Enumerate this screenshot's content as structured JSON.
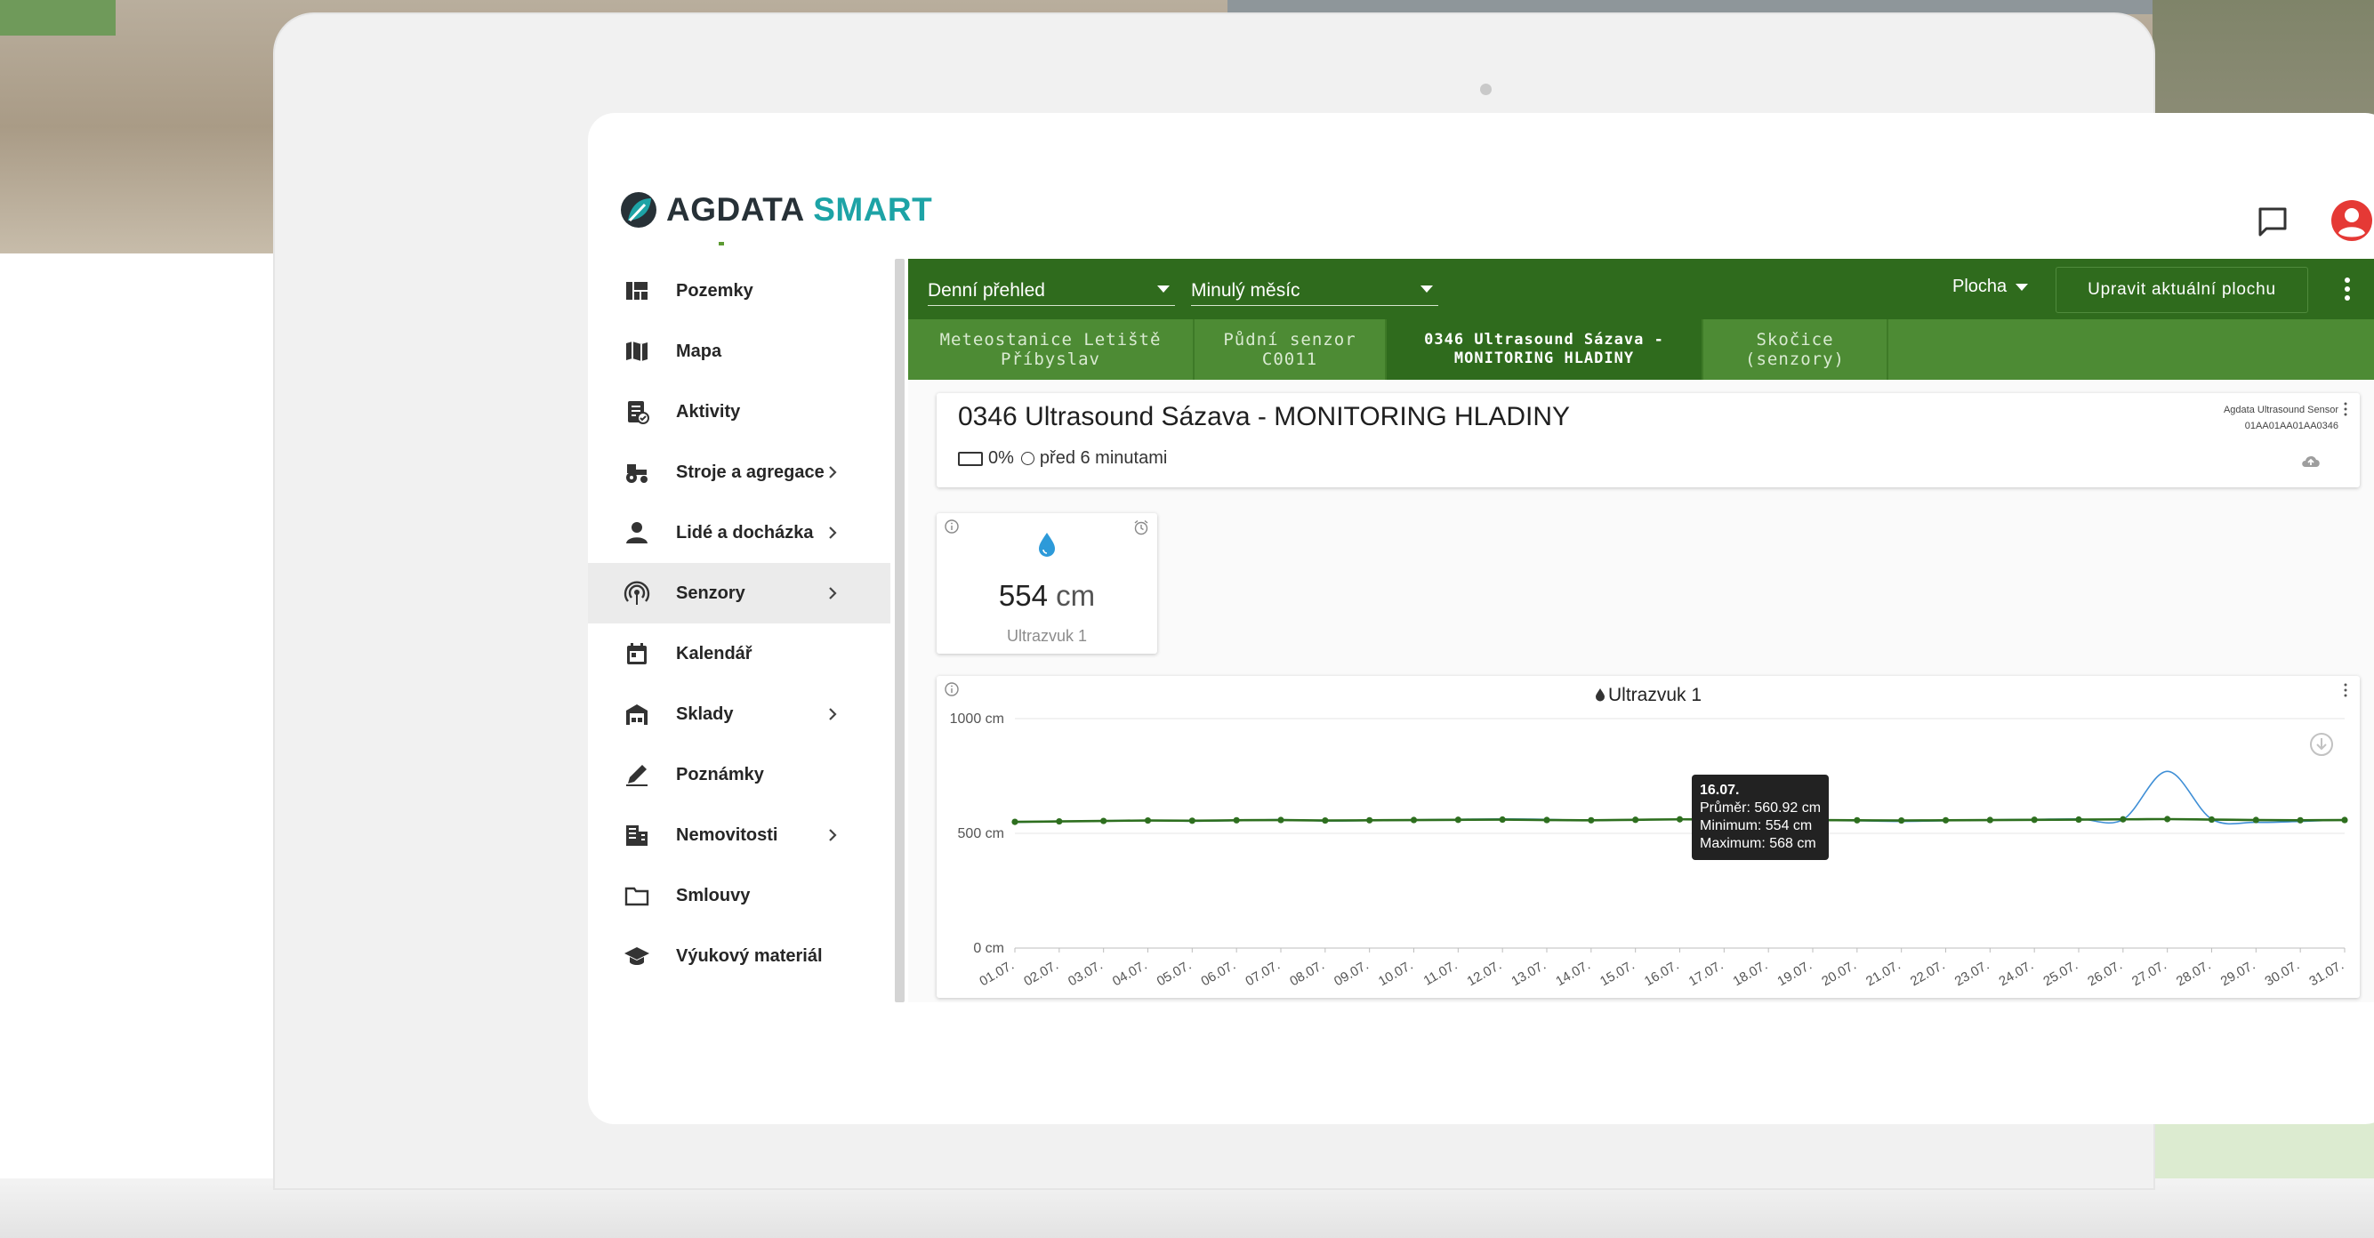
{
  "app": {
    "logo_main": "AGDATA",
    "logo_accent": "SMART",
    "brand_color": "#1da3a6",
    "toolbar_color": "#2f6b1d",
    "tab_color": "#4d8b34",
    "user_color": "#e53935"
  },
  "header": {
    "chat_icon": "chat-icon",
    "user_icon": "account-circle-icon"
  },
  "sidebar": {
    "items": [
      {
        "label": "Pozemky",
        "icon": "dashboard-icon",
        "has_children": false,
        "active": false
      },
      {
        "label": "Mapa",
        "icon": "map-icon",
        "has_children": false,
        "active": false
      },
      {
        "label": "Aktivity",
        "icon": "task-list-icon",
        "has_children": false,
        "active": false
      },
      {
        "label": "Stroje a agregace",
        "icon": "tractor-icon",
        "has_children": true,
        "active": false
      },
      {
        "label": "Lidé a docházka",
        "icon": "person-icon",
        "has_children": true,
        "active": false
      },
      {
        "label": "Senzory",
        "icon": "sensor-icon",
        "has_children": true,
        "active": true
      },
      {
        "label": "Kalendář",
        "icon": "calendar-icon",
        "has_children": false,
        "active": false
      },
      {
        "label": "Sklady",
        "icon": "warehouse-icon",
        "has_children": true,
        "active": false
      },
      {
        "label": "Poznámky",
        "icon": "pencil-icon",
        "has_children": false,
        "active": false
      },
      {
        "label": "Nemovitosti",
        "icon": "building-icon",
        "has_children": true,
        "active": false
      },
      {
        "label": "Smlouvy",
        "icon": "folder-icon",
        "has_children": false,
        "active": false
      },
      {
        "label": "Výukový materiál",
        "icon": "graduation-cap-icon",
        "has_children": false,
        "active": false
      }
    ]
  },
  "toolbar": {
    "view_select": "Denní přehled",
    "period_select": "Minulý měsíc",
    "area_menu": "Plocha",
    "edit_button": "Upravit aktuální plochu"
  },
  "tabs": [
    {
      "label": "Meteostanice Letiště Příbyslav",
      "active": false
    },
    {
      "label": "Půdní senzor C0011",
      "active": false
    },
    {
      "label": "0346 Ultrasound Sázava - MONITORING HLADINY",
      "active": true
    },
    {
      "label": "Skočice (senzory)",
      "active": false
    }
  ],
  "device": {
    "title": "0346 Ultrasound Sázava - MONITORING HLADINY",
    "battery": "0%",
    "last_seen": "před 6 minutami",
    "sensor_type": "Agdata Ultrasound Sensor",
    "sensor_id": "01AA01AA01AA0346"
  },
  "value_card": {
    "value": "554",
    "unit": "cm",
    "label": "Ultrazvuk 1",
    "icon": "water-drop-icon",
    "accent": "#2d9ad9"
  },
  "chart_card": {
    "title": "Ultrazvuk 1",
    "tooltip": {
      "date": "16.07.",
      "avg": "Průměr: 560.92 cm",
      "min": "Minimum: 554 cm",
      "max": "Maximum: 568 cm"
    }
  },
  "chart_data": {
    "type": "line",
    "title": "Ultrazvuk 1",
    "xlabel": "",
    "ylabel": "",
    "ylim": [
      0,
      1000
    ],
    "yticks": [
      "0 cm",
      "500 cm",
      "1000 cm"
    ],
    "categories": [
      "01.07.",
      "02.07.",
      "03.07.",
      "04.07.",
      "05.07.",
      "06.07.",
      "07.07.",
      "08.07.",
      "09.07.",
      "10.07.",
      "11.07.",
      "12.07.",
      "13.07.",
      "14.07.",
      "15.07.",
      "16.07.",
      "17.07.",
      "18.07.",
      "19.07.",
      "20.07.",
      "21.07.",
      "22.07.",
      "23.07.",
      "24.07.",
      "25.07.",
      "26.07.",
      "27.07.",
      "28.07.",
      "29.07.",
      "30.07.",
      "31.07."
    ],
    "series": [
      {
        "color": "#2e6f1f",
        "values": [
          550,
          552,
          554,
          556,
          555,
          557,
          558,
          556,
          557,
          558,
          559,
          560,
          558,
          557,
          559,
          561,
          560,
          559,
          558,
          557,
          556,
          557,
          558,
          559,
          560,
          561,
          562,
          560,
          558,
          557,
          558
        ]
      },
      {
        "color": "#3f8fd6",
        "values": [
          548,
          552,
          555,
          557,
          553,
          556,
          560,
          554,
          556,
          559,
          561,
          563,
          561,
          556,
          560,
          560,
          562,
          561,
          556,
          555,
          552,
          555,
          559,
          561,
          563,
          560,
          770,
          562,
          548,
          552,
          559
        ]
      }
    ],
    "grid": true,
    "legend": "none"
  }
}
